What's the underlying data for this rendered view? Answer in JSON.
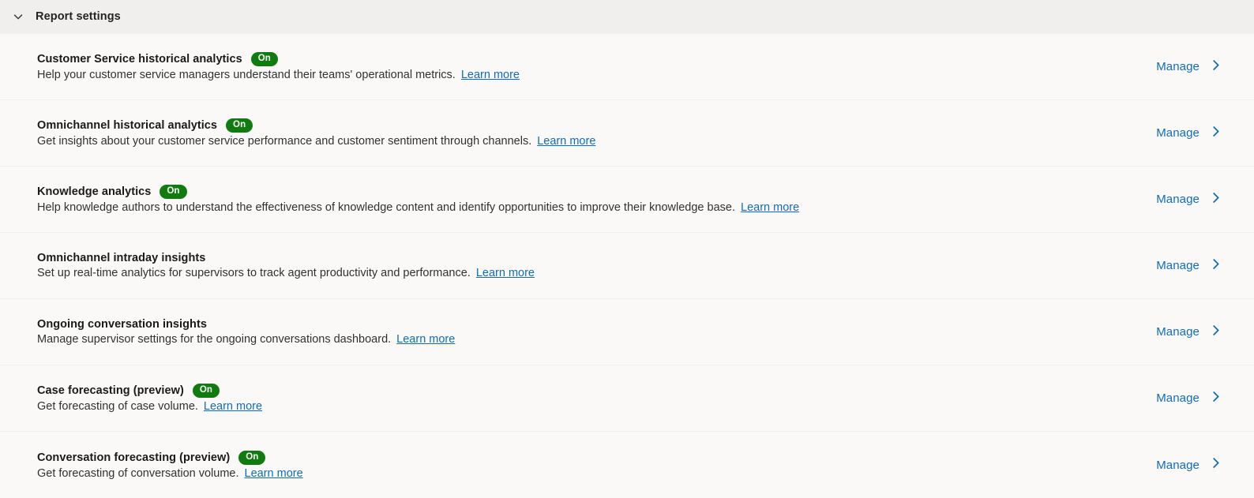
{
  "header": {
    "title": "Report settings",
    "collapse_icon": "chevron-down-icon",
    "collapsed": false
  },
  "common": {
    "manage_label": "Manage",
    "manage_icon": "chevron-right-icon",
    "learn_more_label": "Learn more",
    "badge_on_label": "On"
  },
  "colors": {
    "header_background": "#f0efee",
    "row_background": "#faf9f8",
    "divider": "#f0efee",
    "badge_on": "#107c10",
    "link": "#0f6cbd",
    "title_text": "#1b1a19",
    "body_text": "#323130"
  },
  "rows": [
    {
      "title": "Customer Service historical analytics",
      "badge": "On",
      "has_badge": true,
      "description": "Help your customer service managers understand their teams' operational metrics.",
      "learn_more": "Learn more",
      "action": "Manage"
    },
    {
      "title": "Omnichannel historical analytics",
      "badge": "On",
      "has_badge": true,
      "description": "Get insights about your customer service performance and customer sentiment through channels.",
      "learn_more": "Learn more",
      "action": "Manage"
    },
    {
      "title": "Knowledge analytics",
      "badge": "On",
      "has_badge": true,
      "description": "Help knowledge authors to understand the effectiveness of knowledge content and identify opportunities to improve their knowledge base.",
      "learn_more": "Learn more",
      "action": "Manage"
    },
    {
      "title": "Omnichannel intraday insights",
      "badge": "",
      "has_badge": false,
      "description": "Set up real-time analytics for supervisors to track agent productivity and performance.",
      "learn_more": "Learn more",
      "action": "Manage"
    },
    {
      "title": "Ongoing conversation insights",
      "badge": "",
      "has_badge": false,
      "description": "Manage supervisor settings for the ongoing conversations dashboard.",
      "learn_more": "Learn more",
      "action": "Manage"
    },
    {
      "title": "Case forecasting (preview)",
      "badge": "On",
      "has_badge": true,
      "description": "Get forecasting of case volume.",
      "learn_more": "Learn more",
      "action": "Manage"
    },
    {
      "title": "Conversation forecasting (preview)",
      "badge": "On",
      "has_badge": true,
      "description": "Get forecasting of conversation volume.",
      "learn_more": "Learn more",
      "action": "Manage"
    }
  ]
}
